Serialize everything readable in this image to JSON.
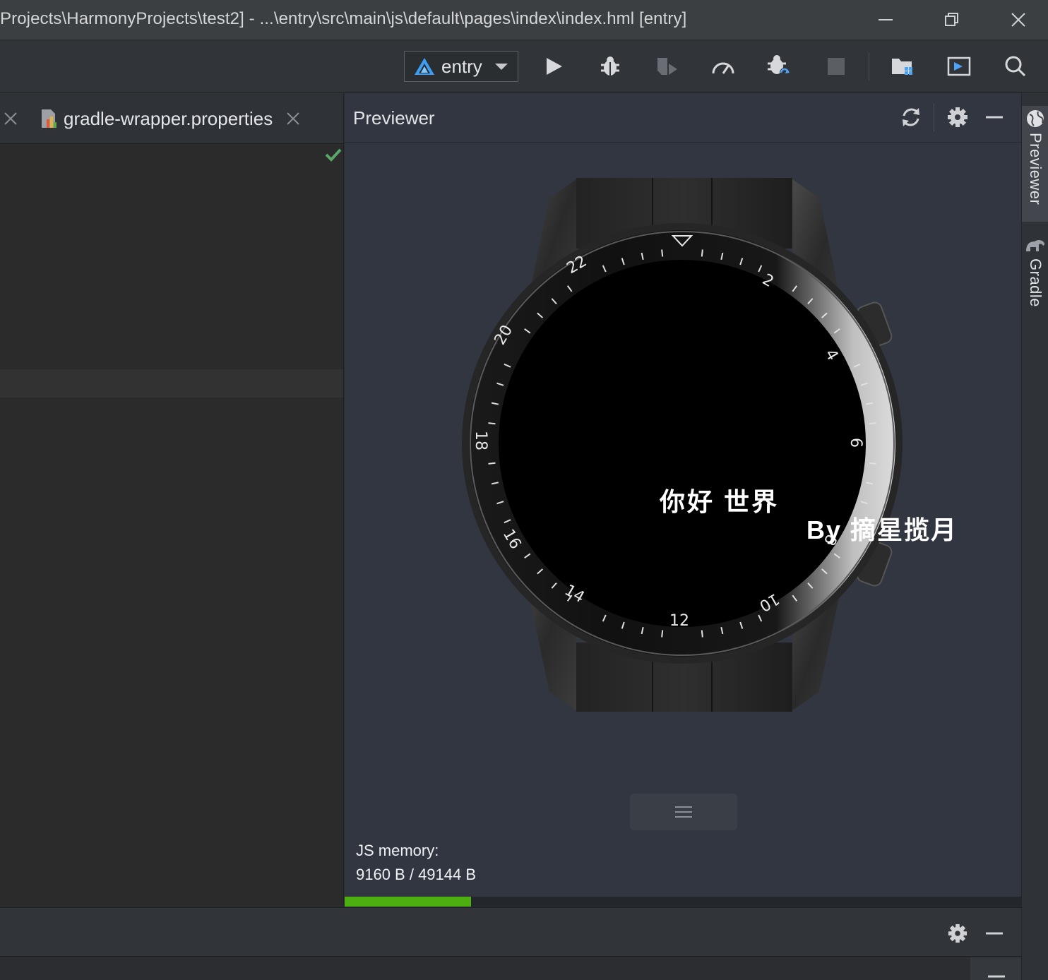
{
  "window": {
    "title": "Projects\\HarmonyProjects\\test2] - ...\\entry\\src\\main\\js\\default\\pages\\index\\index.hml [entry]",
    "minimize_icon": "minimize-icon",
    "restore_icon": "restore-icon",
    "close_icon": "close-icon"
  },
  "toolbar": {
    "run_config": "entry",
    "buttons": [
      "run",
      "debug",
      "attach-debugger",
      "profile",
      "apply-changes",
      "stop",
      "project-structure",
      "device-manager",
      "search"
    ]
  },
  "editor": {
    "tabs": [
      {
        "label": "gradle-wrapper.properties",
        "icon": "gradle-properties-icon",
        "closable": true
      }
    ],
    "status_icon": "check-icon"
  },
  "previewer": {
    "title": "Previewer",
    "actions": [
      "refresh",
      "settings",
      "minimize"
    ],
    "device": "wearable-watch",
    "screen_text": {
      "line1": "你好 世界",
      "line2": "By 摘星揽月"
    },
    "bezel_numbers": [
      "2",
      "4",
      "6",
      "8",
      "10",
      "12",
      "14",
      "16",
      "18",
      "20",
      "22"
    ],
    "js_memory": {
      "label": "JS memory:",
      "value": "9160 B / 49144 B",
      "used": 9160,
      "total": 49144
    },
    "memory_color": "#4cae10"
  },
  "side_tools": [
    {
      "label": "Previewer",
      "icon": "globe-icon",
      "active": true
    },
    {
      "label": "Gradle",
      "icon": "elephant-icon",
      "active": false
    }
  ],
  "bottom_panel": {
    "actions": [
      "settings",
      "minimize"
    ]
  }
}
